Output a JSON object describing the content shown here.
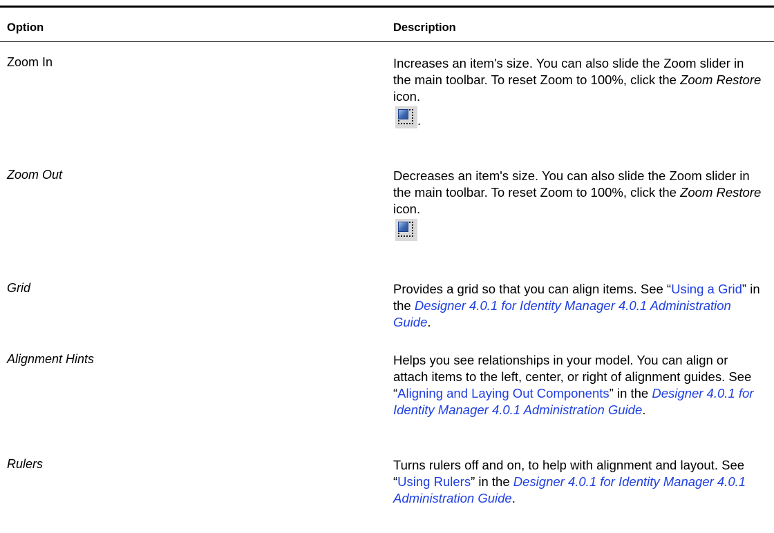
{
  "header": {
    "option": "Option",
    "description": "Description"
  },
  "rows": [
    {
      "option": "Zoom In",
      "description": {
        "text1": "Increases an item's size. You can also slide the Zoom slider in the main toolbar. To reset Zoom to 100%, click the ",
        "em": "Zoom Restore",
        "text2": " icon.",
        "icon": "zoom-restore-icon",
        "after_icon": "."
      }
    },
    {
      "option": "Zoom Out",
      "description": {
        "text1": "Decreases an item's size. You can also slide the Zoom slider in the main toolbar. To reset Zoom to 100%, click the ",
        "em": "Zoom Restore",
        "text2": " icon.",
        "icon": "zoom-restore-icon"
      }
    },
    {
      "option": "Grid",
      "description": {
        "text1": "Provides a grid so that you can align items. See “",
        "link": "Using a Grid",
        "text2": "” in the ",
        "guide": "Designer 4.0.1 for Identity Manager 4.0.1 Administration Guide",
        "text3": "."
      }
    },
    {
      "option": "Alignment Hints",
      "description": {
        "text1": "Helps you see relationships in your model. You can align or attach items to the left, center, or right of alignment guides. See “",
        "link": "Aligning and Laying Out Components",
        "text2": "” in the ",
        "guide": "Designer 4.0.1 for Identity Manager 4.0.1 Administration Guide",
        "text3": "."
      }
    },
    {
      "option": "Rulers",
      "description": {
        "text1": "Turns rulers off and on, to help with alignment and layout. See “",
        "link": "Using Rulers",
        "text2": "” in the ",
        "guide": "Designer 4.0.1 for Identity Manager 4.0.1 Administration Guide",
        "text3": "."
      }
    }
  ],
  "colors": {
    "link": "#1f3fe0",
    "rule": "#000000"
  }
}
